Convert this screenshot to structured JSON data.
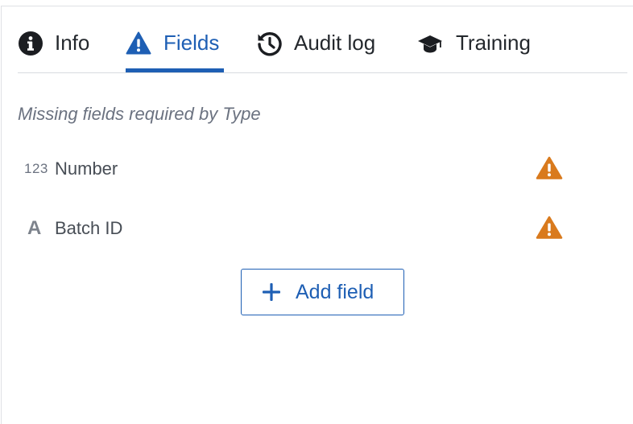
{
  "tabs": [
    {
      "label": "Info",
      "icon": "info-circle-icon",
      "active": false
    },
    {
      "label": "Fields",
      "icon": "warning-triangle-icon",
      "active": true
    },
    {
      "label": "Audit log",
      "icon": "history-icon",
      "active": false
    },
    {
      "label": "Training",
      "icon": "graduation-cap-icon",
      "active": false
    }
  ],
  "missing_fields": {
    "title": "Missing fields required by Type",
    "items": [
      {
        "type_icon": "123",
        "type_name": "number-type-icon",
        "label": "Number",
        "status_icon": "warning-icon"
      },
      {
        "type_icon": "A",
        "type_name": "text-type-icon",
        "label": "Batch ID",
        "status_icon": "warning-icon"
      }
    ]
  },
  "add_field_button": {
    "label": "Add field",
    "icon": "plus-icon"
  },
  "colors": {
    "accent": "#1e5fb4",
    "warning": "#d97a1d",
    "text": "#24282d",
    "muted": "#6b7280",
    "divider": "#d8dbe0"
  }
}
